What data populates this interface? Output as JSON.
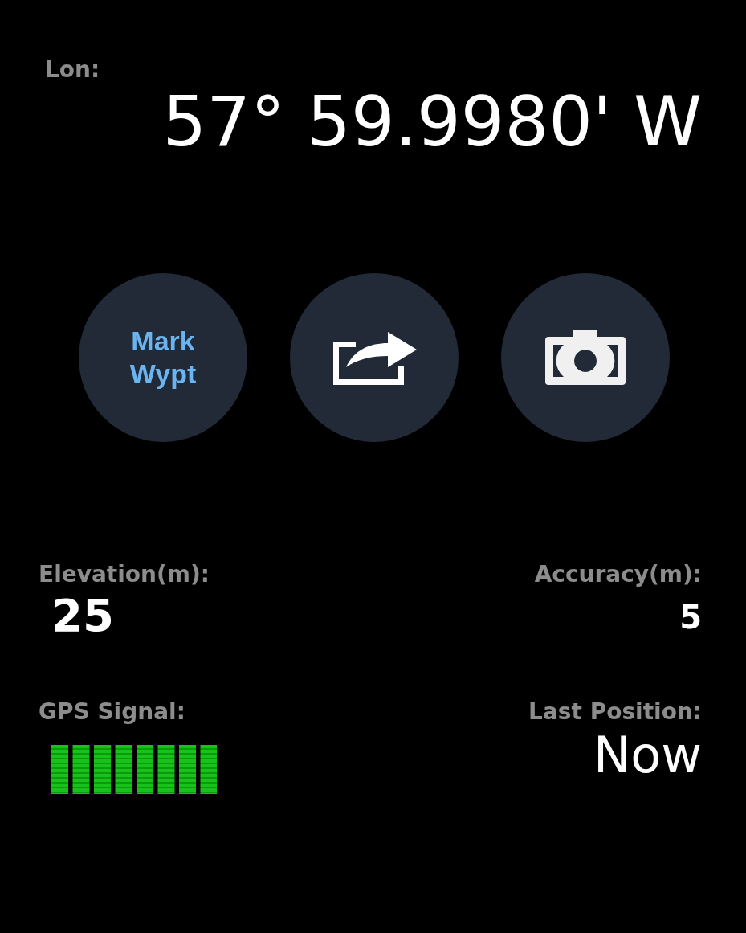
{
  "longitude": {
    "label": "Lon:",
    "value": "57° 59.9980' W"
  },
  "actions": [
    {
      "kind": "text",
      "label": "Mark Wypt"
    },
    {
      "kind": "share"
    },
    {
      "kind": "camera"
    }
  ],
  "stats": [
    {
      "kind": "text",
      "label": "Elevation(m):",
      "value": "25"
    },
    {
      "kind": "text",
      "label": "Accuracy(m):",
      "value": "5"
    },
    {
      "kind": "signal",
      "label": "GPS Signal:"
    },
    {
      "kind": "text",
      "label": "Last Position:",
      "value": "Now"
    }
  ]
}
